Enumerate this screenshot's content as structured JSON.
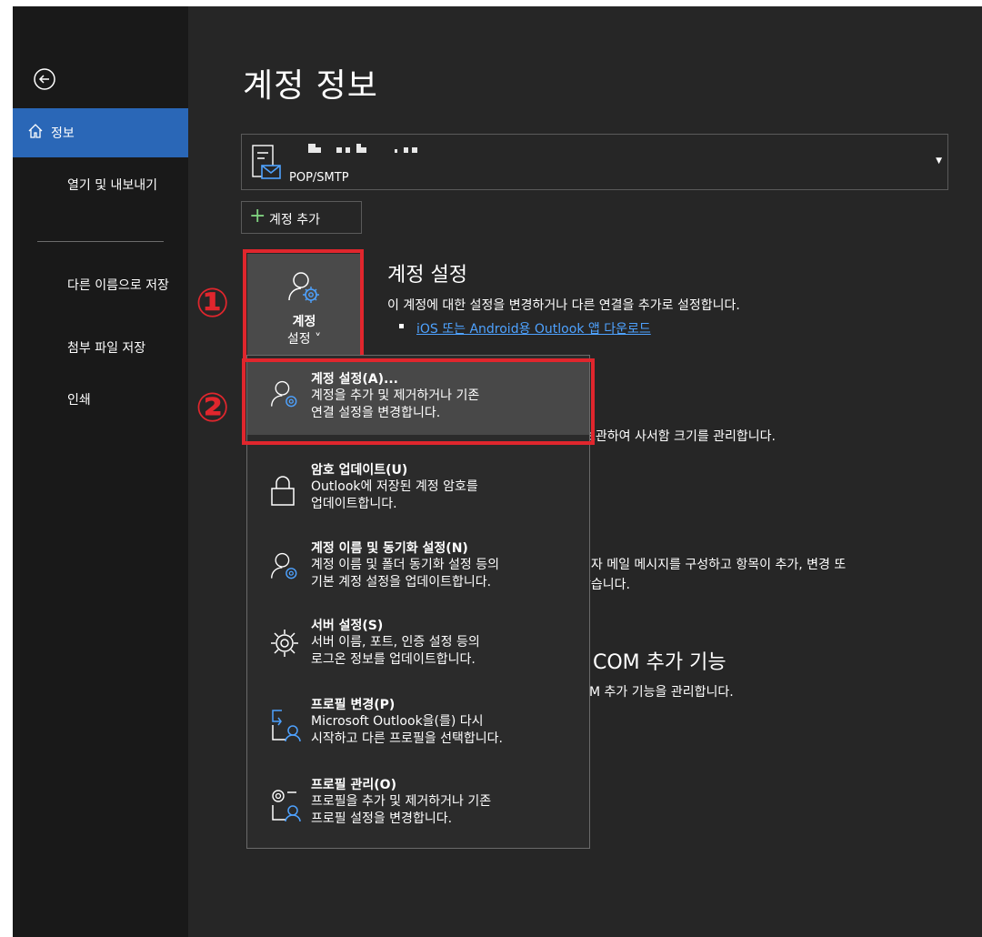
{
  "sidebar": {
    "back_icon": "back-arrow-circle-icon",
    "items": [
      {
        "label": "정보",
        "icon": "home-icon",
        "selected": true
      },
      {
        "label": "열기 및 내보내기"
      },
      {
        "label": "다른 이름으로 저장"
      },
      {
        "label": "첨부 파일 저장"
      },
      {
        "label": "인쇄"
      }
    ]
  },
  "page": {
    "title": "계정 정보"
  },
  "account": {
    "type": "POP/SMTP",
    "icon": "mailbox-icon"
  },
  "add_account": {
    "label": "계정 추가"
  },
  "account_settings": {
    "button_label_line1": "계정",
    "button_label_line2": "설정 ˅",
    "section_title": "계정 설정",
    "section_desc": "이 계정에 대한 설정을 변경하거나 다른 연결을 추가로 설정합니다.",
    "link": "iOS 또는 Android용 Outlook 앱 다운로드"
  },
  "background": {
    "mailbox_desc_partial": "보관하여 사서함 크기를 관리합니다.",
    "rules_desc_line1_partial": "전자 메일 메시지를 구성하고 항목이 추가, 변경 또",
    "rules_desc_line2_partial": "받습니다.",
    "com_title_partial": "COM 추가 기능",
    "com_desc_partial": "OM 추가 기능을 관리합니다."
  },
  "annotations": {
    "step1": "①",
    "step2": "②",
    "highlight_color": "#e0262d"
  },
  "menu": {
    "items": [
      {
        "title": "계정 설정(A)...",
        "desc1": "계정을 추가 및 제거하거나 기존",
        "desc2": "연결 설정을 변경합니다.",
        "icon": "account-settings-icon"
      },
      {
        "title": "암호 업데이트(U)",
        "desc1": "Outlook에 저장된 계정 암호를",
        "desc2": "업데이트합니다.",
        "icon": "lock-icon"
      },
      {
        "title": "계정 이름 및 동기화 설정(N)",
        "desc1": "계정 이름 및 폴더 동기화 설정 등의",
        "desc2": "기본 계정 설정을 업데이트합니다.",
        "icon": "account-sync-icon"
      },
      {
        "title": "서버 설정(S)",
        "desc1": "서버 이름, 포트, 인증 설정 등의",
        "desc2": "로그온 정보를 업데이트합니다.",
        "icon": "gear-icon"
      },
      {
        "title": "프로필 변경(P)",
        "desc1": "Microsoft Outlook을(를) 다시",
        "desc2": "시작하고 다른 프로필을 선택합니다.",
        "icon": "change-profile-icon"
      },
      {
        "title": "프로필 관리(O)",
        "desc1": "프로필을 추가 및 제거하거나 기존",
        "desc2": "프로필 설정을 변경합니다.",
        "icon": "manage-profile-icon"
      }
    ]
  },
  "colors": {
    "accent": "#2a67b7",
    "link": "#4ea2ff",
    "background": "#262626",
    "sidebar": "#191919"
  }
}
